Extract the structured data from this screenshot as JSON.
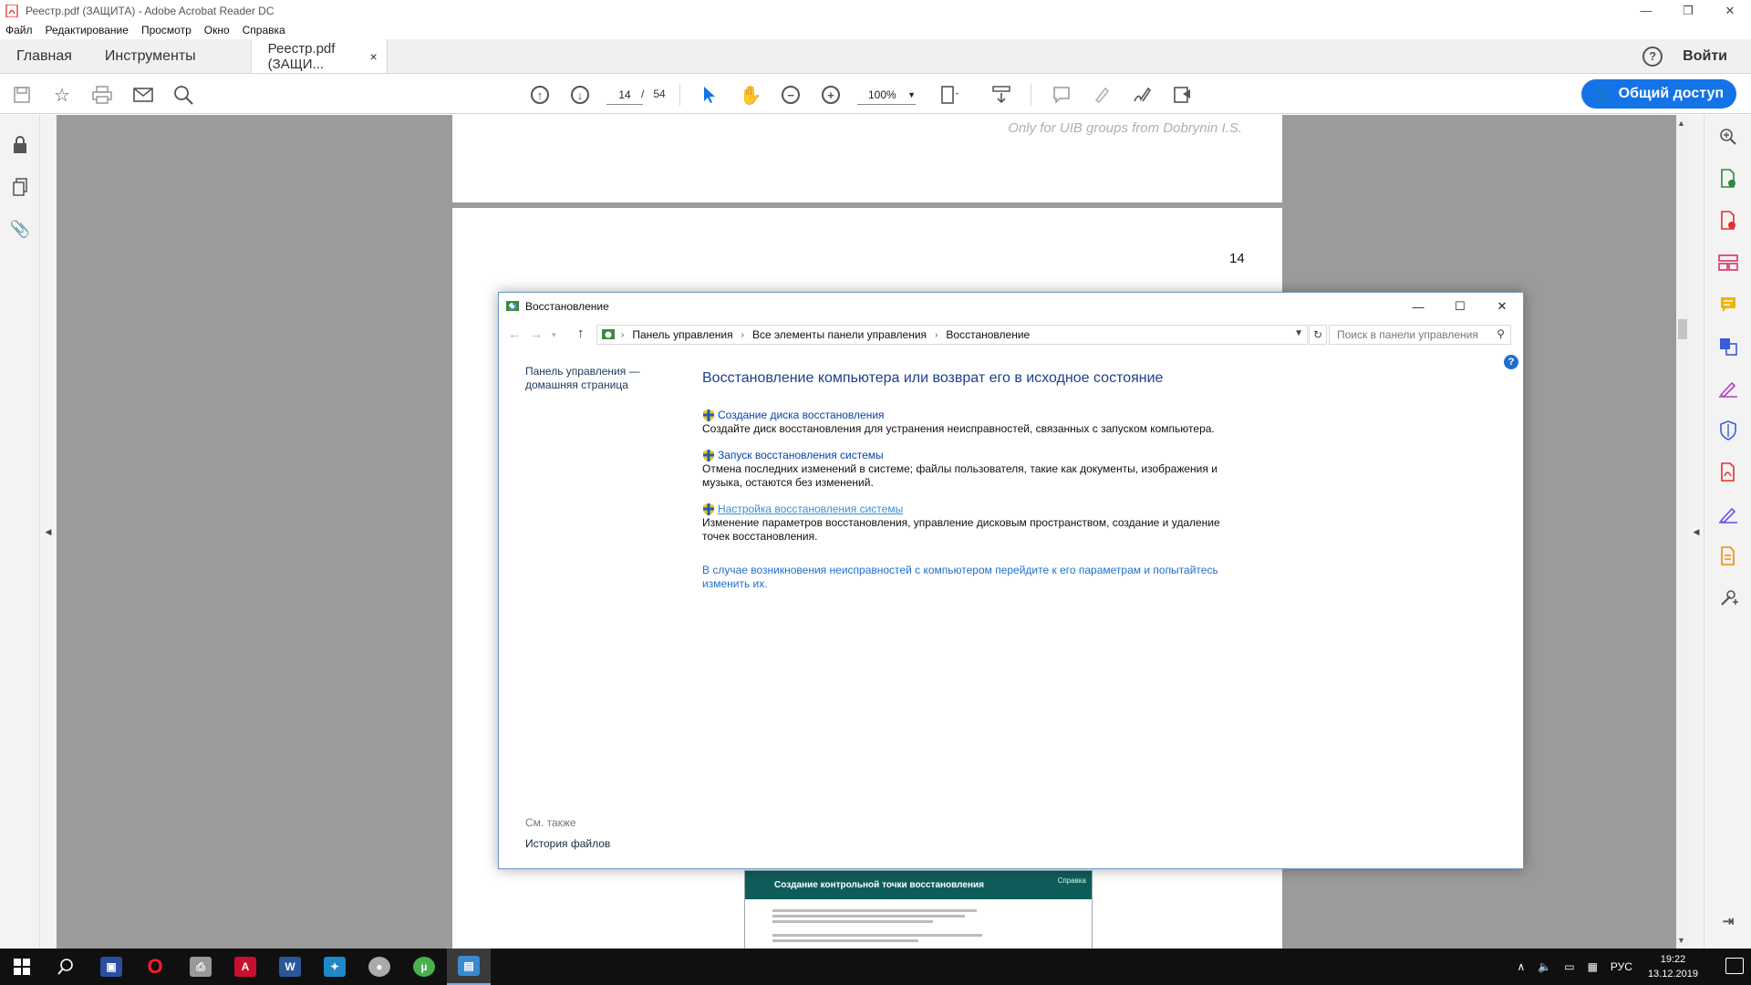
{
  "window": {
    "title": "Реестр.pdf (ЗАЩИТА) - Adobe Acrobat Reader DC",
    "controls": {
      "minimize": "—",
      "restore": "❐",
      "close": "✕"
    }
  },
  "menu": [
    "Файл",
    "Редактирование",
    "Просмотр",
    "Окно",
    "Справка"
  ],
  "tabs": {
    "home": "Главная",
    "tools": "Инструменты",
    "doc": "Реестр.pdf (ЗАЩИ...",
    "doc_close": "×",
    "help": "?",
    "signin": "Войти"
  },
  "toolbar": {
    "current_page": "14",
    "page_sep": "/",
    "total_pages": "54",
    "zoom": "100%",
    "share": "Общий доступ",
    "icons": [
      "save-icon",
      "star-icon",
      "print-icon",
      "mail-icon",
      "search-icon",
      "page-up-icon",
      "page-down-icon",
      "select-cursor-icon",
      "hand-icon",
      "zoom-out-icon",
      "zoom-in-icon",
      "fit-page-icon",
      "scroll-mode-icon",
      "comment-icon",
      "highlight-icon",
      "sign-icon",
      "more-tools-icon"
    ]
  },
  "document": {
    "watermark": "Only for UIB groups from Dobrynin I.S.",
    "page_number": "14",
    "embedded_dialog_title": "Создание контрольной точки восстановления",
    "embedded_dialog_help": "Справка"
  },
  "control_panel": {
    "title": "Восстановление",
    "breadcrumb": [
      "Панель управления",
      "Все элементы панели управления",
      "Восстановление"
    ],
    "search_placeholder": "Поиск в панели управления",
    "left_home_link_line1": "Панель управления —",
    "left_home_link_line2": "домашняя страница",
    "heading": "Восстановление компьютера или возврат его в исходное состояние",
    "items": [
      {
        "link": "Создание диска восстановления",
        "desc": "Создайте диск восстановления для устранения неисправностей, связанных с запуском компьютера."
      },
      {
        "link": "Запуск восстановления системы",
        "desc": "Отмена последних изменений в системе; файлы пользователя, такие как документы, изображения и музыка, остаются без изменений."
      },
      {
        "link": "Настройка восстановления системы",
        "desc": "Изменение параметров восстановления, управление дисковым пространством, создание и удаление точек восстановления."
      }
    ],
    "advanced_link": "В случае возникновения неисправностей с компьютером перейдите к его параметрам и попытайтесь изменить их.",
    "see_also": "См. также",
    "file_history": "История файлов"
  },
  "taskbar": {
    "language": "РУС",
    "time": "19:22",
    "date": "13.12.2019"
  },
  "colors": {
    "accent": "#1473e6",
    "doc_bg": "#9b9b9b",
    "link": "#0645ad",
    "heading": "#1e3f8a",
    "taskbar": "#101010"
  }
}
